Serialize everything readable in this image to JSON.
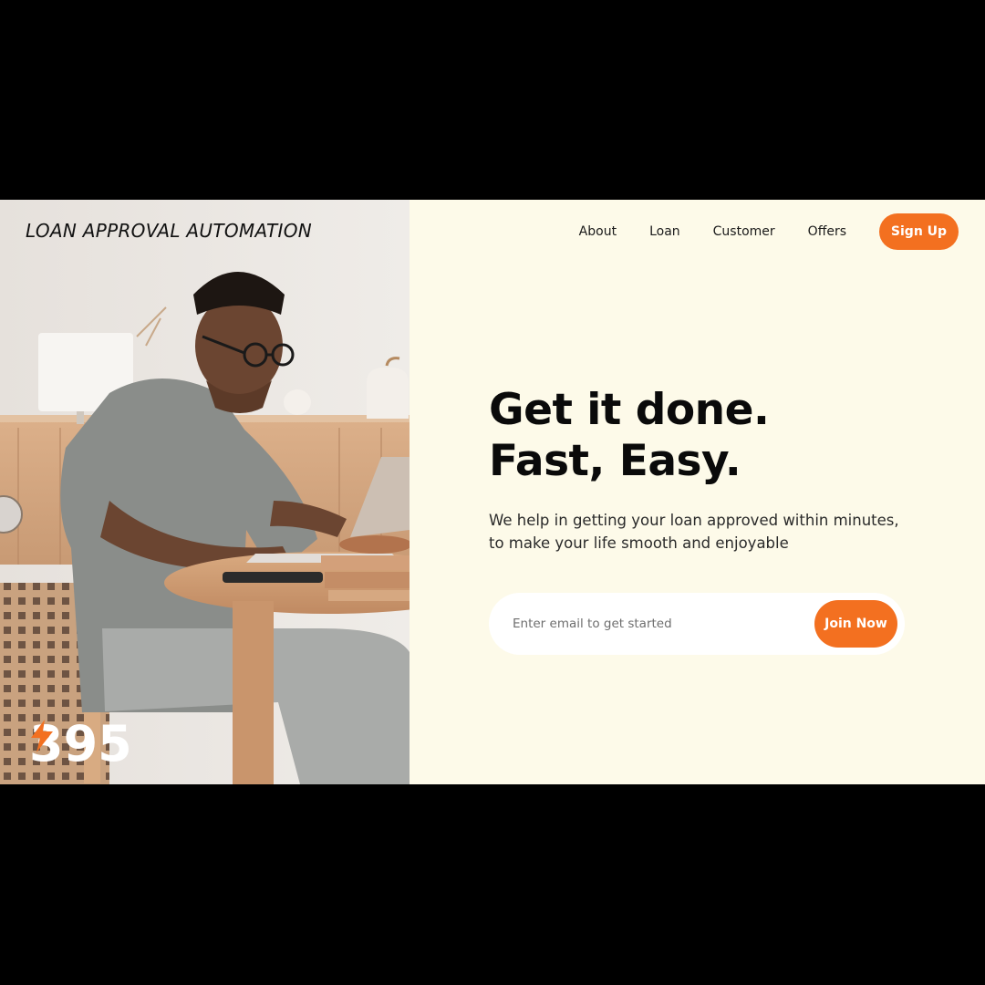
{
  "brand": {
    "title": "LOAN APPROVAL AUTOMATION"
  },
  "nav": {
    "items": [
      {
        "label": "About"
      },
      {
        "label": "Loan"
      },
      {
        "label": "Customer"
      },
      {
        "label": "Offers"
      }
    ],
    "signup_label": "Sign Up"
  },
  "hero": {
    "title_line1": "Get it done.",
    "title_line2": "Fast, Easy.",
    "subtitle": "We help in getting your loan approved within minutes, to make your life smooth and enjoyable"
  },
  "form": {
    "email_placeholder": "Enter email to get started",
    "join_label": "Join Now"
  },
  "counter": {
    "icon": "lightning-bolt-icon",
    "value": "395"
  },
  "colors": {
    "accent": "#f37020",
    "panel_bg": "#fdfae9",
    "text": "#0a0a0a"
  }
}
